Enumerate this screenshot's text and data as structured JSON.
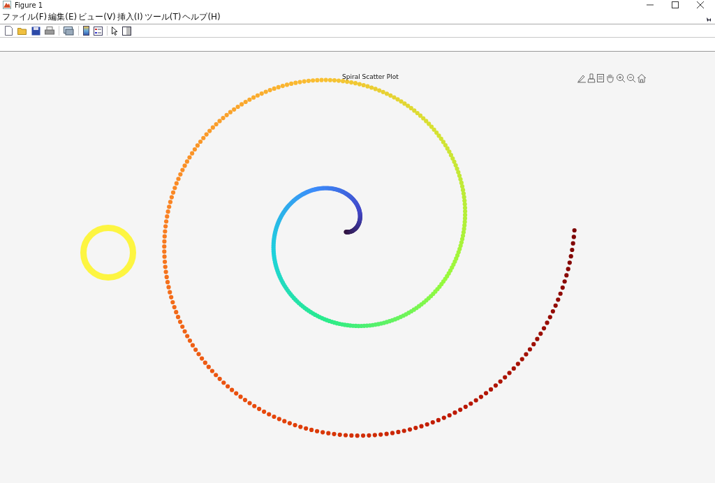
{
  "window": {
    "title": "Figure 1"
  },
  "menu": [
    "ファイル(F)",
    "編集(E)",
    "ビュー(V)",
    "挿入(I)",
    "ツール(T)",
    "ヘルプ(H)"
  ],
  "plot": {
    "title": "Spiral Scatter Plot"
  }
}
